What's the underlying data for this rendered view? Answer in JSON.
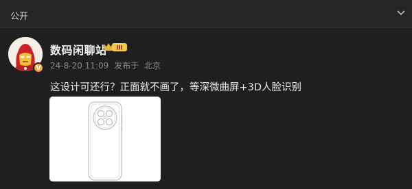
{
  "header": {
    "visibility_label": "公开"
  },
  "post": {
    "author": {
      "name": "数码闲聊站",
      "verified_mark": "V",
      "level_badge": "III"
    },
    "meta": {
      "timestamp": "24-8-20 11:09",
      "posted_from_label": "发布于",
      "location": "北京"
    },
    "text": "这设计可还行？正面就不画了，等深微曲屏+3D人脸识别"
  },
  "colors": {
    "background": "#1f1f1f",
    "topbar": "#262626",
    "verified_orange": "#f6a13a",
    "level_badge_gold": "#e6b53c"
  },
  "icons": {
    "dropdown": "chevron-down-icon",
    "level": "level-badge-icon",
    "verified": "verified-badge-icon"
  }
}
